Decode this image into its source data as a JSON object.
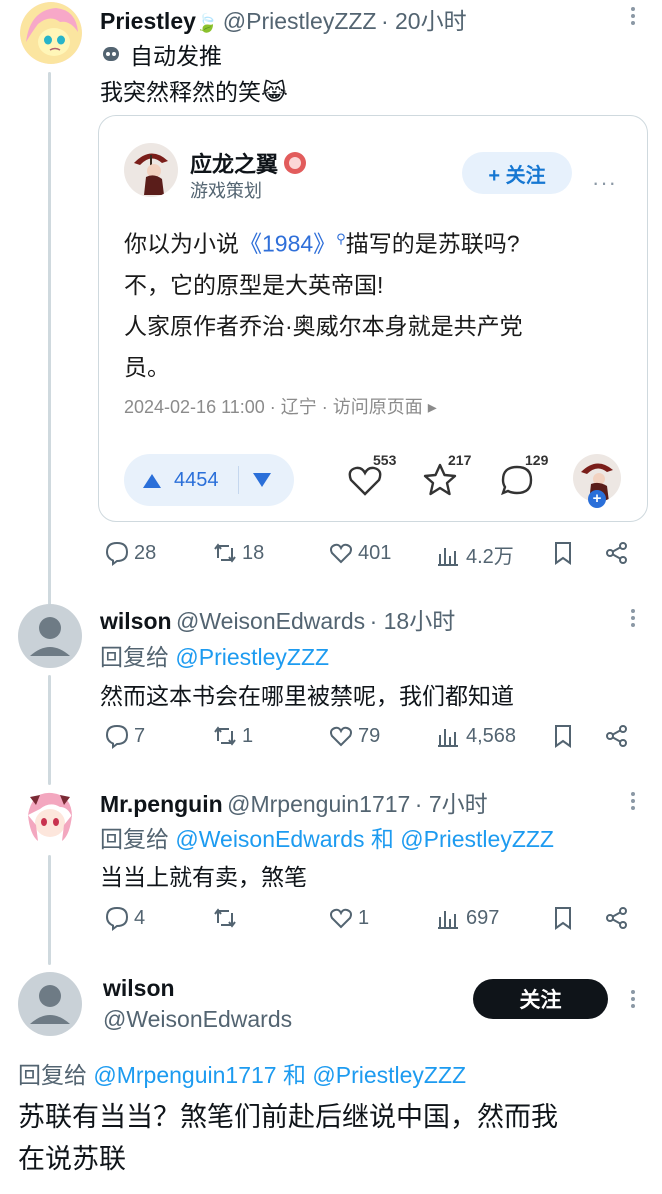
{
  "tweet1": {
    "name": "Priestley",
    "leaf_emoji": "🍃",
    "handle": "@PriestleyZZZ",
    "time": "· 20小时",
    "auto_label": "自动发推",
    "text": "我突然释然的笑",
    "emoji": "😹",
    "card": {
      "name": "应龙之翼",
      "subtitle": "游戏策划",
      "follow": "+ 关注",
      "line1_a": "你以为小说",
      "line1_link": "《1984》",
      "line1_b": "描写的是苏联吗?",
      "line2": "不，它的原型是大英帝国!",
      "line3": "人家原作者乔治·奥威尔本身就是共产党",
      "line4": "员。",
      "meta": "2024-02-16 11:00 · 辽宁 · 访问原页面 ▸",
      "votes": "4454",
      "likes": "553",
      "favs": "217",
      "comments": "129"
    },
    "actions": {
      "reply": "28",
      "retweet": "18",
      "like": "401",
      "views": "4.2万"
    }
  },
  "tweet2": {
    "name": "wilson",
    "handle": "@WeisonEdwards",
    "time": "· 18小时",
    "reply_prefix": "回复给",
    "reply_to": "@PriestleyZZZ",
    "text": "然而这本书会在哪里被禁呢，我们都知道",
    "actions": {
      "reply": "7",
      "retweet": "1",
      "like": "79",
      "views": "4,568"
    }
  },
  "tweet3": {
    "name": "Mr.penguin",
    "handle": "@Mrpenguin1717",
    "time": "· 7小时",
    "reply_prefix": "回复给",
    "reply_to1": "@WeisonEdwards",
    "and": "和",
    "reply_to2": "@PriestleyZZZ",
    "text": "当当上就有卖，煞笔",
    "actions": {
      "reply": "4",
      "retweet": "",
      "like": "1",
      "views": "697"
    }
  },
  "tweet4": {
    "name": "wilson",
    "handle": "@WeisonEdwards",
    "follow": "关注",
    "reply_prefix": "回复给",
    "reply_to1": "@Mrpenguin1717",
    "and": "和",
    "reply_to2": "@PriestleyZZZ",
    "text_line1": "苏联有当当？煞笔们前赴后继说中国，然而我",
    "text_line2": "在说苏联"
  },
  "colors": {
    "link": "#1d9bf0",
    "muted": "#536471",
    "pill": "#e7f1fc",
    "dark_button": "#0f1419"
  }
}
